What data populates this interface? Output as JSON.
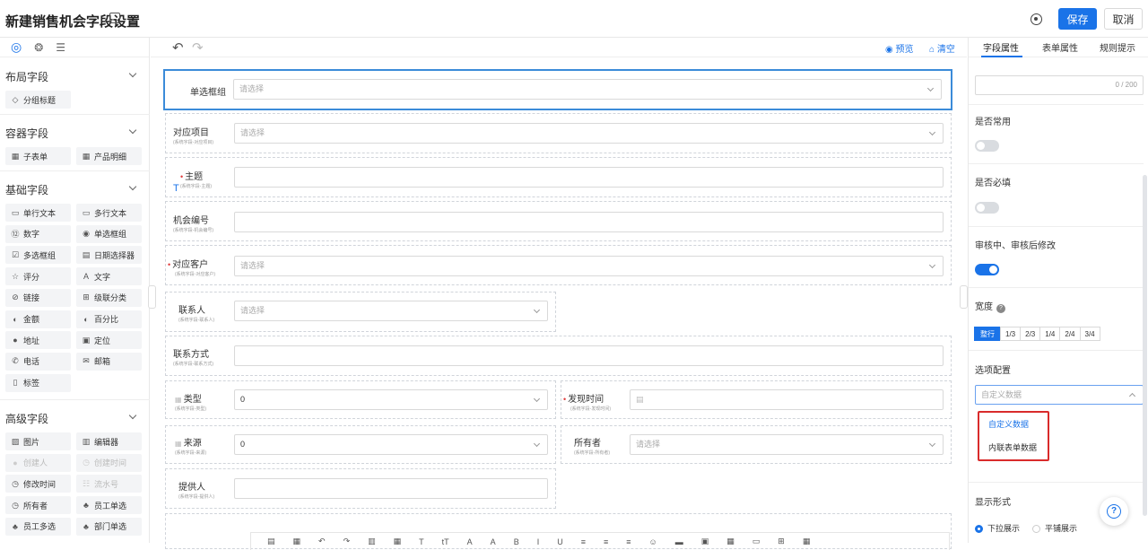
{
  "header": {
    "title": "新建销售机会字段设置",
    "save_label": "保存",
    "cancel_label": "取消"
  },
  "left_panel": {
    "tabs": [
      "◎",
      "❂",
      "☰"
    ],
    "sections": [
      {
        "title": "布局字段",
        "items": [
          {
            "label": "分组标题",
            "icon": "◇",
            "disabled": false
          }
        ]
      },
      {
        "title": "容器字段",
        "items": [
          {
            "label": "子表单",
            "icon": "▦",
            "disabled": false
          },
          {
            "label": "产品明细",
            "icon": "▦",
            "disabled": false
          }
        ]
      },
      {
        "title": "基础字段",
        "items": [
          {
            "label": "单行文本",
            "icon": "▭",
            "disabled": false
          },
          {
            "label": "多行文本",
            "icon": "▭",
            "disabled": false
          },
          {
            "label": "数字",
            "icon": "⑫",
            "disabled": false
          },
          {
            "label": "单选框组",
            "icon": "◉",
            "disabled": false
          },
          {
            "label": "多选框组",
            "icon": "☑",
            "disabled": false
          },
          {
            "label": "日期选择器",
            "icon": "▤",
            "disabled": false
          },
          {
            "label": "评分",
            "icon": "☆",
            "disabled": false
          },
          {
            "label": "文字",
            "icon": "A",
            "disabled": false
          },
          {
            "label": "链接",
            "icon": "⊘",
            "disabled": false
          },
          {
            "label": "级联分类",
            "icon": "⊞",
            "disabled": false
          },
          {
            "label": "金额",
            "icon": "◐",
            "disabled": false
          },
          {
            "label": "百分比",
            "icon": "◐",
            "disabled": false
          },
          {
            "label": "地址",
            "icon": "●",
            "disabled": false
          },
          {
            "label": "定位",
            "icon": "▣",
            "disabled": false
          },
          {
            "label": "电话",
            "icon": "✆",
            "disabled": false
          },
          {
            "label": "邮箱",
            "icon": "✉",
            "disabled": false
          },
          {
            "label": "标签",
            "icon": "▯",
            "disabled": false
          }
        ]
      },
      {
        "title": "高级字段",
        "items": [
          {
            "label": "图片",
            "icon": "▨",
            "disabled": false
          },
          {
            "label": "编辑器",
            "icon": "▥",
            "disabled": false
          },
          {
            "label": "创建人",
            "icon": "●",
            "disabled": true
          },
          {
            "label": "创建时间",
            "icon": "◷",
            "disabled": true
          },
          {
            "label": "修改时间",
            "icon": "◷",
            "disabled": false
          },
          {
            "label": "流水号",
            "icon": "☷",
            "disabled": true
          },
          {
            "label": "所有者",
            "icon": "◷",
            "disabled": false
          },
          {
            "label": "员工单选",
            "icon": "♣",
            "disabled": false
          },
          {
            "label": "员工多选",
            "icon": "♣",
            "disabled": false
          },
          {
            "label": "部门单选",
            "icon": "♣",
            "disabled": false
          }
        ]
      }
    ]
  },
  "canvas_toolbar": {
    "undo": "↶",
    "redo": "↷",
    "preview": "◉ 预览",
    "clear": "⌂ 清空"
  },
  "form_fields": {
    "f1": {
      "label": "单选框组",
      "sub": "",
      "placeholder": "请选择"
    },
    "f2": {
      "label": "对应项目",
      "sub": "(系统字段-对应项目)",
      "placeholder": "请选择"
    },
    "f3": {
      "label": "主题",
      "sub": "(系统字段-主题)",
      "placeholder": ""
    },
    "f4": {
      "label": "机会编号",
      "sub": "(系统字段-机会编号)",
      "placeholder": ""
    },
    "f5": {
      "label": "对应客户",
      "sub": "(系统字段-对应客户)",
      "placeholder": "请选择"
    },
    "f6": {
      "label": "联系人",
      "sub": "(系统字段-联系人)",
      "placeholder": "请选择"
    },
    "f7": {
      "label": "联系方式",
      "sub": "(系统字段-联系方式)",
      "placeholder": ""
    },
    "f8": {
      "label": "类型",
      "sub": "(系统字段-类型)",
      "value": "0"
    },
    "f9": {
      "label": "发现时间",
      "sub": "(系统字段-发现时间)",
      "placeholder": ""
    },
    "f10": {
      "label": "来源",
      "sub": "(系统字段-来源)",
      "value": "0"
    },
    "f11": {
      "label": "所有者",
      "sub": "(系统字段-所有者)",
      "placeholder": "请选择"
    },
    "f12": {
      "label": "提供人",
      "sub": "(系统字段-提供人)",
      "placeholder": ""
    }
  },
  "rich_text_toolbar": [
    "▤",
    "▦",
    "↶",
    "↷",
    "▥",
    "▦",
    "T",
    "tT",
    "A",
    "A",
    "B",
    "I",
    "U",
    "≡",
    "≡",
    "≡",
    "☺",
    "▬",
    "▣",
    "▦",
    "▭",
    "⊞",
    "▦"
  ],
  "right_panel": {
    "tabs": [
      "字段属性",
      "表单属性",
      "规则提示"
    ],
    "counter": "0 / 200",
    "common_label": "是否常用",
    "required_label": "是否必填",
    "editable_label": "审核中、审核后修改",
    "width_label": "宽度",
    "width_options": [
      "整行",
      "1/3",
      "2/3",
      "1/4",
      "2/4",
      "3/4"
    ],
    "options_label": "选项配置",
    "options_placeholder": "自定义数据",
    "dropdown_items": [
      "自定义数据",
      "内联表单数据"
    ],
    "display_label": "显示形式",
    "display_options": [
      "下拉展示",
      "平铺展示"
    ]
  },
  "colors": {
    "accent": "#1a73e8",
    "highlight": "#d92b2b"
  }
}
